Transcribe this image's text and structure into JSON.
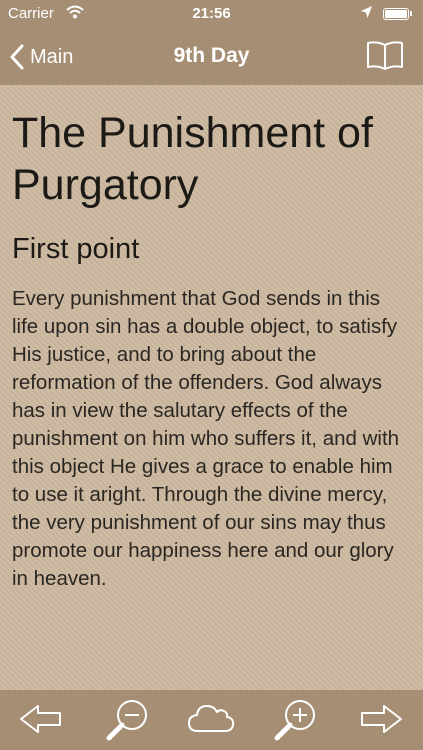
{
  "status": {
    "carrier": "Carrier",
    "time": "21:56"
  },
  "nav": {
    "back_label": "Main",
    "title": "9th Day"
  },
  "content": {
    "heading": "The Punishment of Purgatory",
    "subheading": "First point",
    "body": "Every punishment that God sends in this life upon sin has a double object, to satisfy His justice, and to bring about the reformation of the offenders. God always has in view the salutary effects of the punishment on him who suffers it, and with this object He gives a grace to enable him to use it aright. Through the divine mercy, the very punishment of our sins may thus promote our happiness here and our glory in heaven."
  },
  "icons": {
    "wifi": "wifi-icon",
    "location": "location-arrow-icon",
    "battery": "battery-icon",
    "back": "chevron-left-icon",
    "book": "book-icon",
    "prev": "arrow-left-icon",
    "zoom_out": "zoom-out-icon",
    "cloud": "cloud-icon",
    "zoom_in": "zoom-in-icon",
    "next": "arrow-right-icon"
  },
  "colors": {
    "bar_background": "#a58e73",
    "page_background": "#cdb9a0",
    "text": "#1c1a17",
    "bar_foreground": "#ffffff"
  }
}
